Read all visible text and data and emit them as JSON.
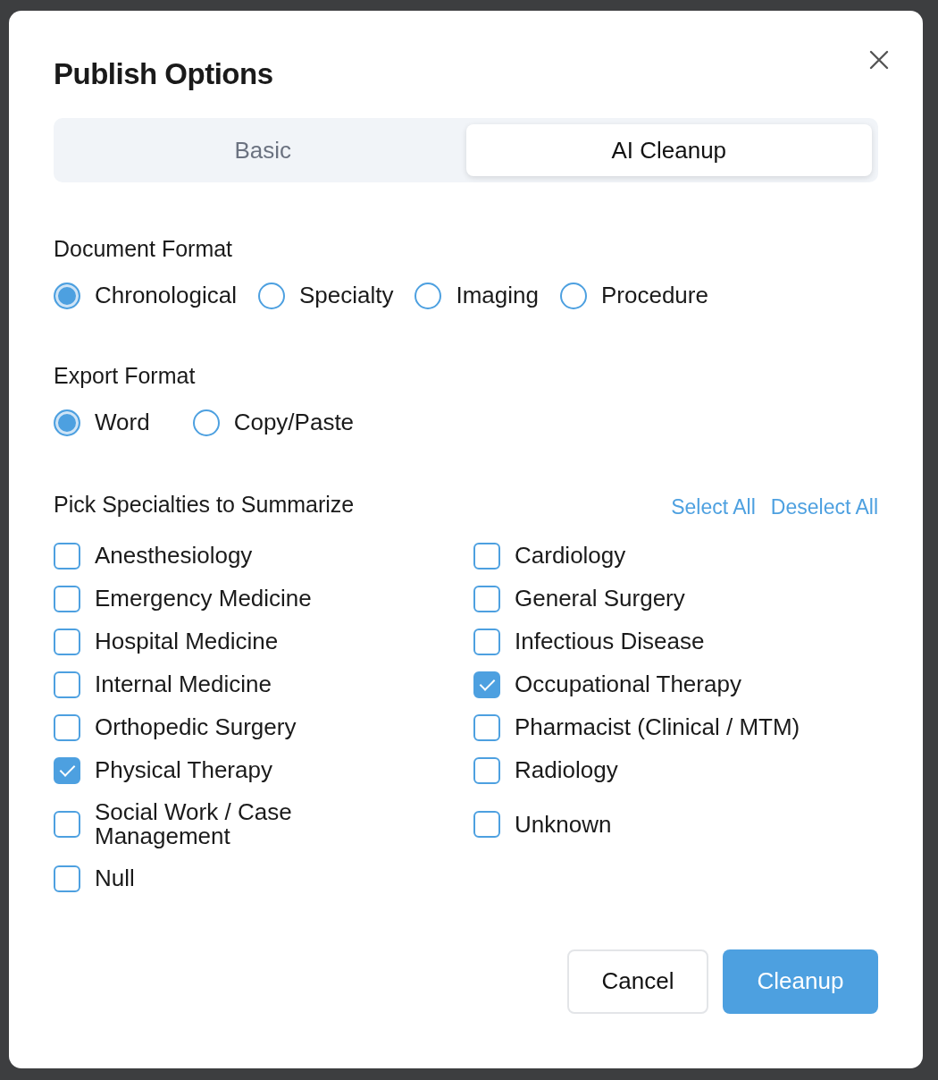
{
  "dialog": {
    "title": "Publish Options"
  },
  "tabs": [
    {
      "label": "Basic",
      "selected": false
    },
    {
      "label": "AI Cleanup",
      "selected": true
    }
  ],
  "document_format": {
    "label": "Document Format",
    "options": [
      {
        "label": "Chronological",
        "selected": true
      },
      {
        "label": "Specialty",
        "selected": false
      },
      {
        "label": "Imaging",
        "selected": false
      },
      {
        "label": "Procedure",
        "selected": false
      }
    ]
  },
  "export_format": {
    "label": "Export Format",
    "options": [
      {
        "label": "Word",
        "selected": true
      },
      {
        "label": "Copy/Paste",
        "selected": false
      }
    ]
  },
  "specialties": {
    "label": "Pick Specialties to Summarize",
    "select_all": "Select All",
    "deselect_all": "Deselect All",
    "items": [
      {
        "label": "Anesthesiology",
        "checked": false
      },
      {
        "label": "Cardiology",
        "checked": false
      },
      {
        "label": "Emergency Medicine",
        "checked": false
      },
      {
        "label": "General Surgery",
        "checked": false
      },
      {
        "label": "Hospital Medicine",
        "checked": false
      },
      {
        "label": "Infectious Disease",
        "checked": false
      },
      {
        "label": "Internal Medicine",
        "checked": false
      },
      {
        "label": "Occupational Therapy",
        "checked": true
      },
      {
        "label": "Orthopedic Surgery",
        "checked": false
      },
      {
        "label": "Pharmacist (Clinical / MTM)",
        "checked": false
      },
      {
        "label": "Physical Therapy",
        "checked": true
      },
      {
        "label": "Radiology",
        "checked": false
      },
      {
        "label": "Social Work / Case Management",
        "checked": false
      },
      {
        "label": "Unknown",
        "checked": false
      },
      {
        "label": "Null",
        "checked": false
      }
    ]
  },
  "buttons": {
    "cancel": "Cancel",
    "confirm": "Cleanup"
  }
}
